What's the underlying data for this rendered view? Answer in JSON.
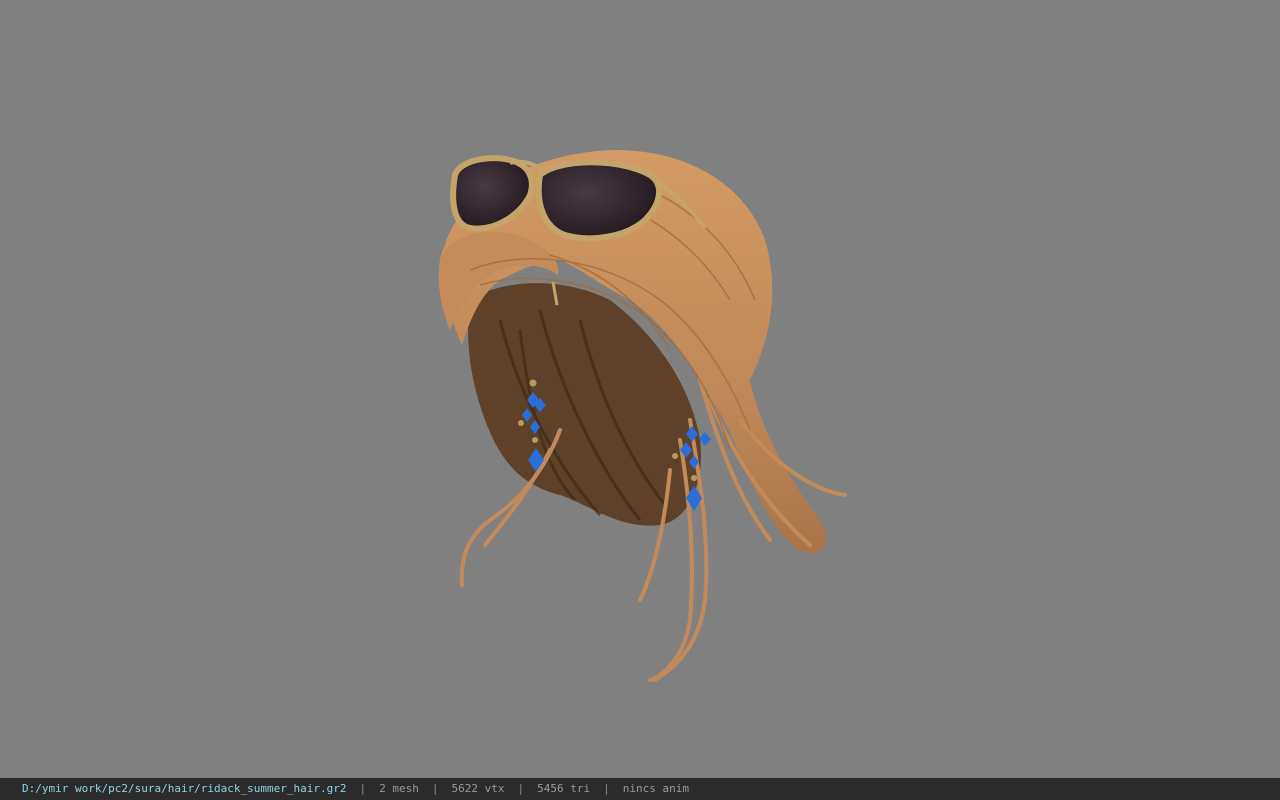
{
  "viewport": {
    "background": "#808080",
    "model": {
      "hair_color": "#c9915e",
      "hair_shadow": "#6b4a2c",
      "glasses_frame": "#c4a46a",
      "glasses_lens": "#2a2026",
      "earring_gem": "#2a6fd8",
      "earring_bead": "#b89a60"
    }
  },
  "status": {
    "file_path": "D:/ymir work/pc2/sura/hair/ridack_summer_hair.gr2",
    "sep": "|",
    "mesh": "2 mesh",
    "vertices": "5622 vtx",
    "triangles": "5456 tri",
    "anim": "nincs anim"
  }
}
